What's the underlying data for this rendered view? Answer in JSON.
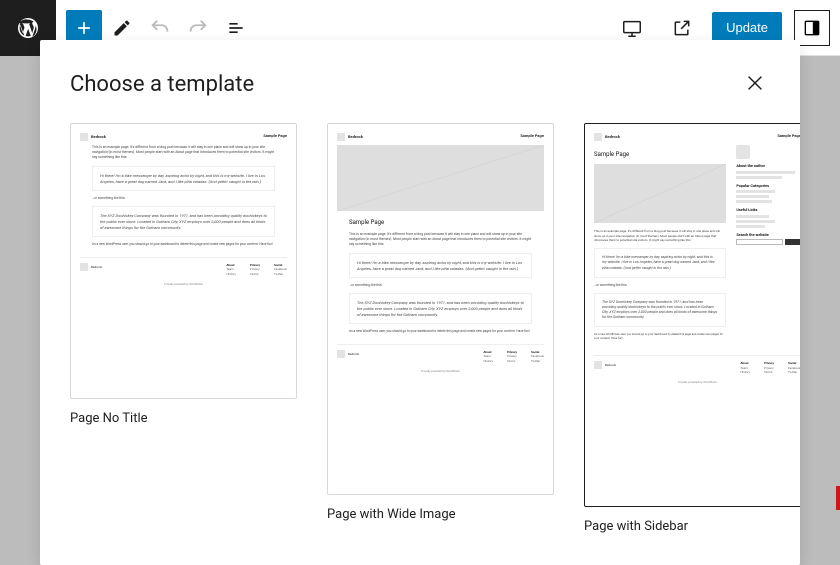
{
  "toolbar": {
    "update_label": "Update"
  },
  "modal": {
    "title": "Choose a template",
    "templates": [
      {
        "label": "Page No Title",
        "selected": false
      },
      {
        "label": "Page with Wide Image",
        "selected": false
      },
      {
        "label": "Page with Sidebar",
        "selected": true
      }
    ]
  },
  "preview": {
    "brand": "Bedrock",
    "sample": "Sample Page",
    "intro": "This is an example page. It's different from a blog post because it will stay in one place and will show up in your site navigation (in most themes). Most people start with an About page that introduces them to potential site visitors. It might say something like this:",
    "quote1": "Hi there! I'm a bike messenger by day, aspiring actor by night, and this is my website. I live in Los Angeles, have a great dog named Jack, and I like piña coladas. (And gettin' caught in the rain.)",
    "mid": "…or something like this:",
    "quote2": "The XYZ Doohickey Company was founded in 1971, and has been providing quality doohickeys to the public ever since. Located in Gotham City, XYZ employs over 2,000 people and does all kinds of awesome things for the Gotham community.",
    "outro": "As a new WordPress user, you should go to your dashboard to delete this page and create new pages for your content. Have fun!",
    "footer_cols": [
      "About",
      "Privacy",
      "Social"
    ],
    "credit": "Proudly powered by WordPress",
    "sidebar": {
      "about": "About the author",
      "cats": "Popular Categories",
      "links": "Useful Links",
      "search": "Search the website"
    }
  }
}
